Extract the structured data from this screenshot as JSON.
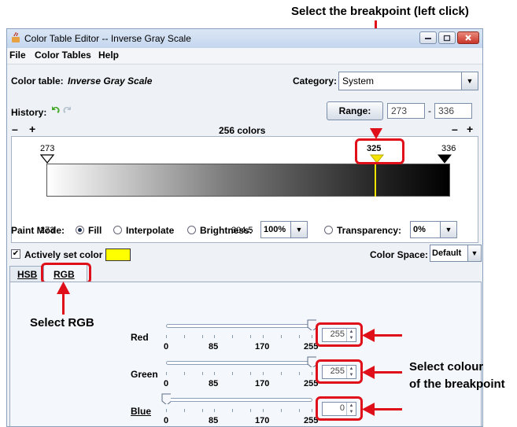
{
  "callouts": {
    "breakpoint": "Select the breakpoint (left click)",
    "rgb": "Select RGB",
    "colour_line1": "Select colour",
    "colour_line2": "of the breakpoint"
  },
  "window": {
    "title": "Color Table Editor -- Inverse Gray Scale",
    "menu": [
      "File",
      "Color Tables",
      "Help"
    ]
  },
  "color_table": {
    "label": "Color table:",
    "name": "Inverse Gray Scale",
    "category_label": "Category:",
    "category_value": "System"
  },
  "history": {
    "label": "History:",
    "range_button": "Range:",
    "range_min": "273",
    "range_sep": "-",
    "range_max": "336"
  },
  "editor": {
    "minus": "–",
    "plus": "+",
    "colors_count": "256 colors",
    "top_labels": [
      "273",
      "325",
      "336"
    ],
    "bottom_labels": [
      "273",
      "304.5",
      "336"
    ],
    "selected_breakpoint_fraction": 0.83
  },
  "paint_mode": {
    "label": "Paint Mode:",
    "options": [
      "Fill",
      "Interpolate",
      "Brightness:"
    ],
    "brightness_value": "100%",
    "transparency_label": "Transparency:",
    "transparency_value": "0%"
  },
  "active_color": {
    "label": "Actively set color",
    "swatch": "#ffff00",
    "color_space_label": "Color Space:",
    "color_space_value": "Default"
  },
  "tabs": [
    "HSB",
    "RGB"
  ],
  "sliders": {
    "tick_labels": [
      "0",
      "85",
      "170",
      "255"
    ],
    "channels": [
      {
        "label": "Red",
        "value": "255",
        "fraction": 1.0
      },
      {
        "label": "Green",
        "value": "255",
        "fraction": 1.0
      },
      {
        "label": "Blue",
        "value": "0",
        "fraction": 0.0
      }
    ]
  },
  "colors": {
    "accent_red": "#e0101a",
    "marker_yellow": "#f5e400"
  }
}
